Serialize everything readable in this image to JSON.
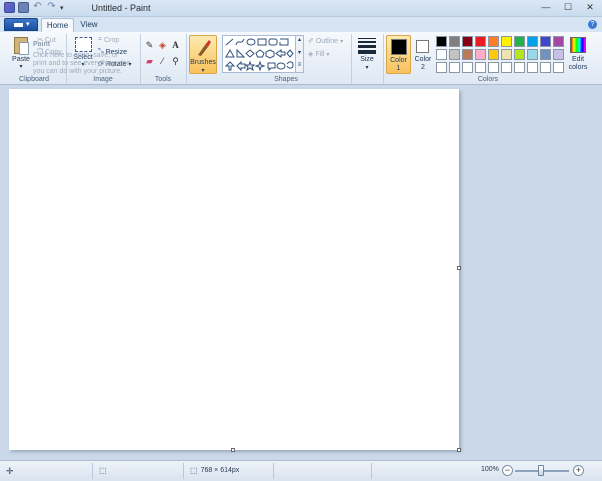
{
  "titlebar": {
    "title": "Untitled - Paint"
  },
  "tabs": {
    "home": "Home",
    "view": "View"
  },
  "clipboard": {
    "paste": "Paste",
    "cut": "Cut",
    "copy": "Copy",
    "group": "Clipboard"
  },
  "image": {
    "select": "Select",
    "crop": "Crop",
    "resize": "Resize",
    "rotate": "Rotate",
    "group": "Image"
  },
  "tooltip": {
    "title": "Paint",
    "text": "Click here to open, save, or print and to see everything else you can do with your picture."
  },
  "tools": {
    "group": "Tools"
  },
  "brushes": {
    "label": "Brushes"
  },
  "shapes": {
    "outline": "Outline",
    "fill": "Fill",
    "group": "Shapes"
  },
  "size": {
    "label": "Size"
  },
  "colors": {
    "color1": "Color 1",
    "color2": "Color 2",
    "edit": "Edit colors",
    "group": "Colors",
    "color1_value": "#000000",
    "color2_value": "#ffffff",
    "palette": [
      "#000000",
      "#7f7f7f",
      "#880015",
      "#ed1c24",
      "#ff7f27",
      "#fff200",
      "#22b14c",
      "#00a2e8",
      "#3f48cc",
      "#a349a4",
      "#ffffff",
      "#c3c3c3",
      "#b97a57",
      "#ffaec9",
      "#ffc90e",
      "#efe4b0",
      "#b5e61d",
      "#99d9ea",
      "#7092be",
      "#c8bfe7",
      "#ffffff",
      "#ffffff",
      "#ffffff",
      "#ffffff",
      "#ffffff",
      "#ffffff",
      "#ffffff",
      "#ffffff",
      "#ffffff",
      "#ffffff"
    ]
  },
  "status": {
    "dimensions": "768 × 614px",
    "zoom": "100%"
  }
}
